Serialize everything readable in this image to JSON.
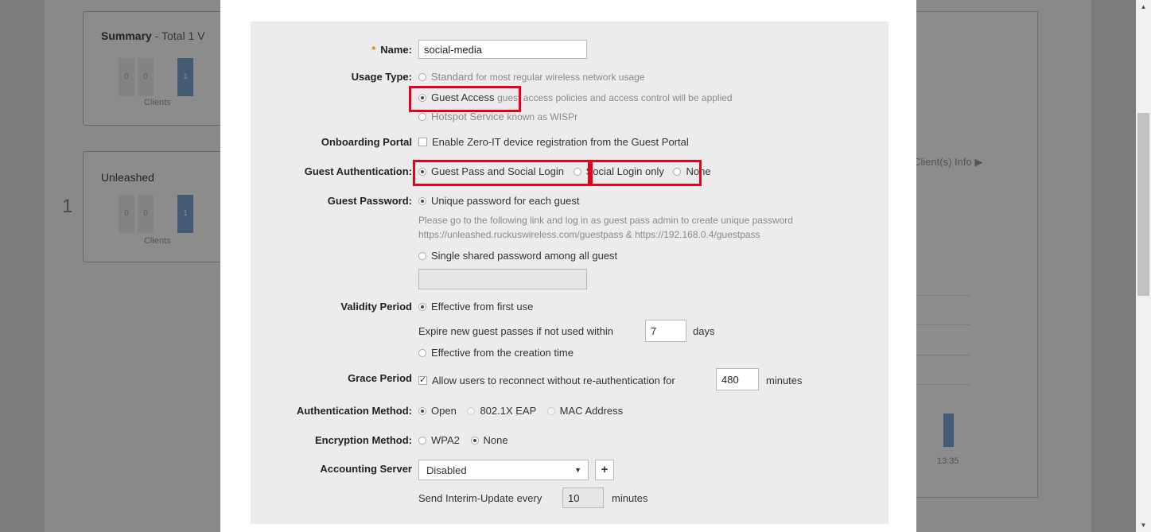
{
  "background": {
    "summary_title": "Summary",
    "summary_sub": " - Total 1 V",
    "clients_label": "Clients",
    "card2_title": "Unleashed",
    "card2_number": "1",
    "box_values": [
      "0",
      "0",
      "1"
    ],
    "info_link": "Client(s) Info",
    "time_tick": "13:35"
  },
  "form": {
    "name": {
      "label": "Name:",
      "required_mark": "*",
      "value": "social-media"
    },
    "usage_type": {
      "label": "Usage Type:",
      "options": [
        {
          "label": "Standard",
          "hint": "for most regular wireless network usage",
          "selected": false
        },
        {
          "label": "Guest Access",
          "hint": "guest access policies and access control will be applied",
          "selected": true
        },
        {
          "label": "Hotspot Service",
          "hint": "known as WISPr",
          "selected": false
        }
      ]
    },
    "onboarding_portal": {
      "label": "Onboarding Portal",
      "checkbox_label": "Enable Zero-IT device registration from the Guest Portal",
      "checked": false
    },
    "guest_authentication": {
      "label": "Guest Authentication:",
      "options": [
        "Guest Pass and Social Login",
        "Social Login only",
        "None"
      ],
      "selected": "Guest Pass and Social Login"
    },
    "guest_password": {
      "label": "Guest Password:",
      "option_unique": "Unique password for each guest",
      "help_line1": "Please go to the following link and log in as guest pass admin to create unique password",
      "help_line2": "https://unleashed.ruckuswireless.com/guestpass & https://192.168.0.4/guestpass",
      "option_shared": "Single shared password among all guest",
      "shared_value": ""
    },
    "validity_period": {
      "label": "Validity Period",
      "option_first_use": "Effective from first use",
      "expire_prefix": "Expire new guest passes if not used within",
      "expire_value": "7",
      "expire_unit": "days",
      "option_creation": "Effective from the creation time"
    },
    "grace_period": {
      "label": "Grace Period",
      "checkbox_label": "Allow users to reconnect without re-authentication for",
      "value": "480",
      "unit": "minutes",
      "checked": true
    },
    "authentication_method": {
      "label": "Authentication Method:",
      "options": [
        "Open",
        "802.1X EAP",
        "MAC Address"
      ],
      "selected": "Open"
    },
    "encryption_method": {
      "label": "Encryption Method:",
      "options": [
        "WPA2",
        "None"
      ],
      "selected": "None"
    },
    "accounting_server": {
      "label": "Accounting Server",
      "selected": "Disabled",
      "add_button": "+"
    },
    "interim_update": {
      "prefix": "Send Interim-Update every",
      "value": "10",
      "unit": "minutes"
    }
  },
  "colors": {
    "highlight": "#e8001c",
    "required": "#e0801a",
    "panel": "#ececec"
  }
}
